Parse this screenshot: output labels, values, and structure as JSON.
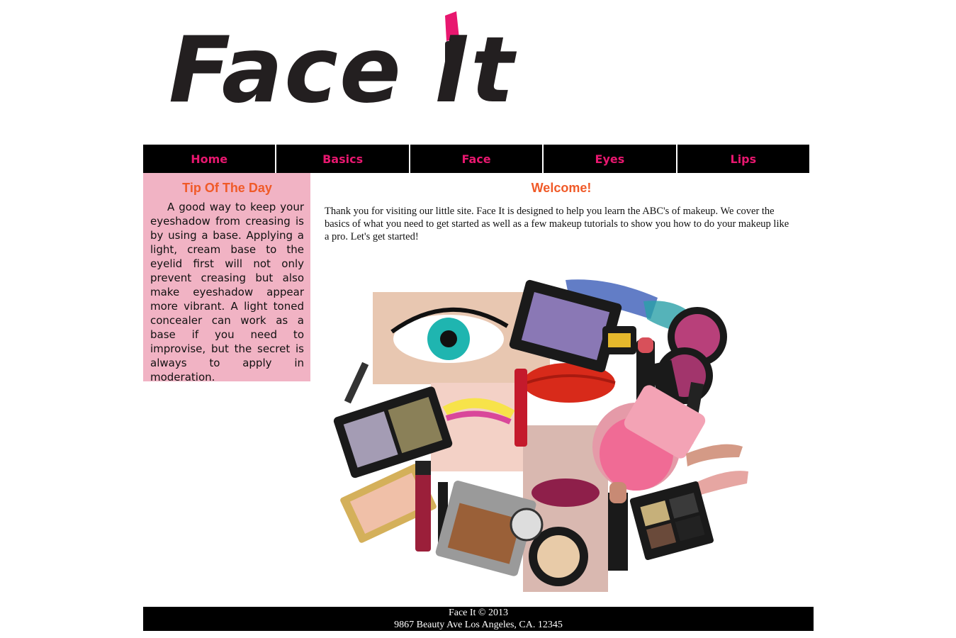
{
  "logo": {
    "text": "Face It",
    "lipstick_color": "#e8176f",
    "text_color": "#231f20"
  },
  "nav": {
    "items": [
      {
        "label": "Home"
      },
      {
        "label": "Basics"
      },
      {
        "label": "Face"
      },
      {
        "label": "Eyes"
      },
      {
        "label": "Lips"
      }
    ],
    "text_color": "#e8176f",
    "background": "#000000"
  },
  "tip": {
    "title": "Tip Of The Day",
    "body": "A good way to keep your eyeshadow from creasing is by using a base. Applying a light, cream base to the eyelid first will not only prevent creasing but also make eyeshadow appear more vibrant. A light toned concealer can work as a base if you need to improvise, but the secret is always to apply in moderation.",
    "background": "#f1b3c4",
    "title_color": "#f05a28"
  },
  "main": {
    "title": "Welcome!",
    "text": "Thank you for visiting our little site. Face It is designed to help you learn the ABC's of makeup. We cover the basics of what you need to get started as well as a few makeup tutorials to show you how to do your makeup like a pro. Let's get started!"
  },
  "footer": {
    "line1": "Face It © 2013",
    "line2": "9867 Beauty Ave Los Angeles, CA. 12345"
  }
}
